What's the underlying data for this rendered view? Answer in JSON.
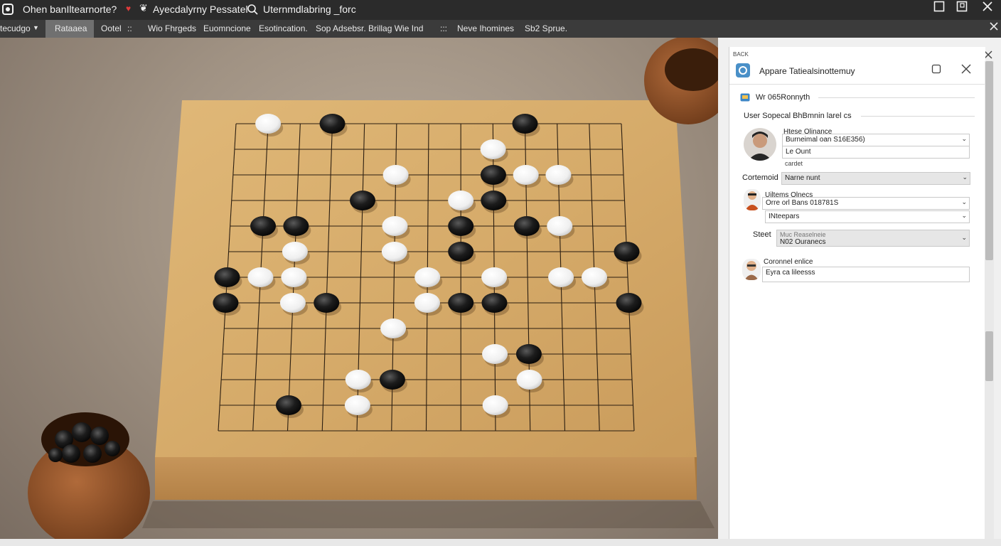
{
  "window": {
    "title": "Ohen banIltearnorte?",
    "title_part2": "Ayecdalyrny Pessatel",
    "search_text": "Uternmdlabring _forc"
  },
  "menubar": {
    "items": [
      "tecudgo",
      "Rataaea",
      "Ootel",
      "Wio Fhrgeds",
      "Euomncione",
      "Esotincation.",
      "Sop Adsebsr. Brillag Wie Ind",
      "Neve Ihomines",
      "Sb2 Sprue."
    ],
    "extra": [
      "::",
      ":::"
    ]
  },
  "dialog": {
    "tiny_label": "BACK",
    "title": "Appare Tatiealsinottemuy",
    "section_title": "Wr 065Ronnyth",
    "section_subtitle": "User Sopecal BhBmnin larel cs",
    "profile1": {
      "name": "Htese Olinance",
      "field_value": "Burneimal oan S16E356)",
      "line2": "Le Ount",
      "line3": "cardet"
    },
    "row_label_1": "Cortemoid",
    "row_value_1": "Narne nunt",
    "profile2": {
      "name": "Uiltems Olnecs",
      "field_value": "Orre orl Bans 018781S",
      "select_value": "INteepars"
    },
    "row_label_2": "Steet",
    "row_value_2_a": "Muc Reaselneie",
    "row_value_2_b": "N02 Ouranecs",
    "profile3": {
      "name": "Coronnel enlice",
      "field_value": "Eyra ca lileesss"
    }
  },
  "board": {
    "size": 13,
    "white_stones": [
      [
        1,
        0
      ],
      [
        8,
        1
      ],
      [
        5,
        2
      ],
      [
        9,
        2
      ],
      [
        10,
        2
      ],
      [
        7,
        3
      ],
      [
        5,
        4
      ],
      [
        10,
        4
      ],
      [
        2,
        5
      ],
      [
        5,
        5
      ],
      [
        1,
        6
      ],
      [
        2,
        6
      ],
      [
        6,
        6
      ],
      [
        8,
        6
      ],
      [
        10,
        6
      ],
      [
        11,
        6
      ],
      [
        2,
        7
      ],
      [
        6,
        7
      ],
      [
        5,
        8
      ],
      [
        8,
        9
      ],
      [
        4,
        10
      ],
      [
        9,
        10
      ],
      [
        4,
        11
      ],
      [
        8,
        11
      ]
    ],
    "black_stones": [
      [
        3,
        0
      ],
      [
        9,
        0
      ],
      [
        8,
        2
      ],
      [
        4,
        3
      ],
      [
        8,
        3
      ],
      [
        1,
        4
      ],
      [
        2,
        4
      ],
      [
        7,
        4
      ],
      [
        9,
        4
      ],
      [
        7,
        5
      ],
      [
        12,
        5
      ],
      [
        0,
        6
      ],
      [
        0,
        7
      ],
      [
        3,
        7
      ],
      [
        7,
        7
      ],
      [
        8,
        7
      ],
      [
        12,
        7
      ],
      [
        9,
        9
      ],
      [
        5,
        10
      ],
      [
        2,
        11
      ]
    ]
  },
  "colors": {
    "board_wood": "#d4a865",
    "titlebar": "#2b2b2b",
    "menubar": "#3b3b3b",
    "accent": "#4a90c8"
  }
}
